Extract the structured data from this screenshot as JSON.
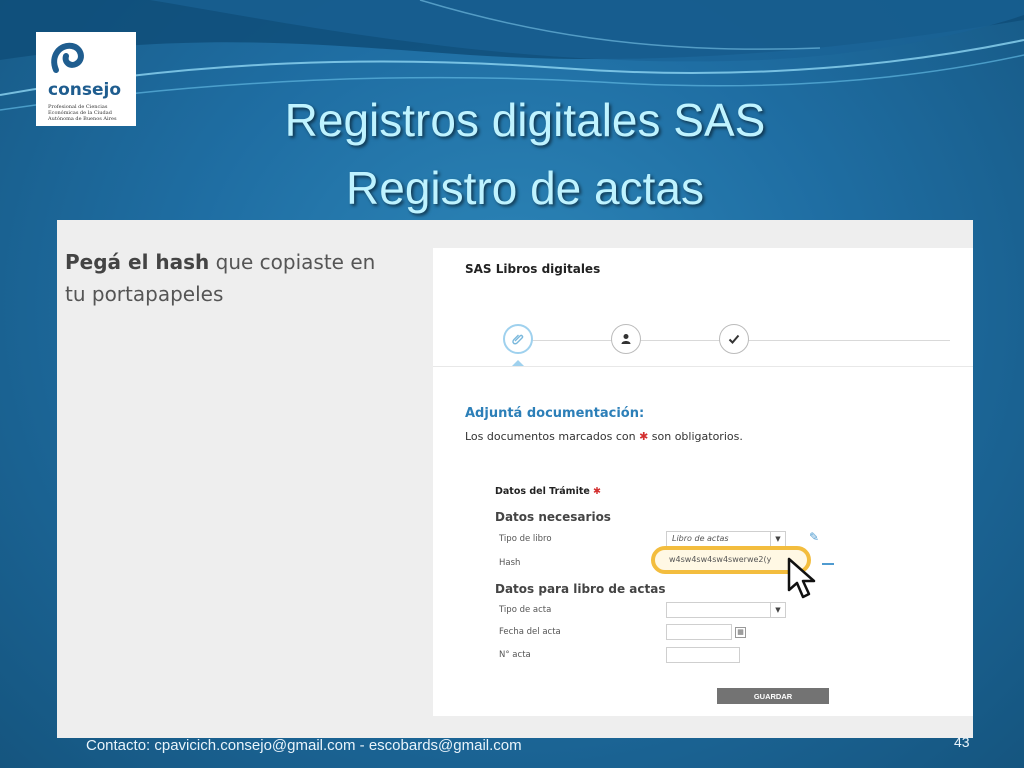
{
  "logo": {
    "name": "consejo",
    "subtitle": "Profesional de Ciencias Económicas de la Ciudad Autónoma de Buenos Aires"
  },
  "slide": {
    "title_line1": "Registros digitales SAS",
    "title_line2": "Registro de actas"
  },
  "hint": {
    "bold": "Pegá el hash",
    "rest": " que copiaste en tu portapapeles"
  },
  "form": {
    "card_title": "SAS Libros digitales",
    "steps": [
      {
        "icon": "paperclip-icon",
        "glyph": "🔗",
        "active": true
      },
      {
        "icon": "person-icon",
        "glyph": "👤",
        "active": false
      },
      {
        "icon": "check-icon",
        "glyph": "✔",
        "active": false
      }
    ],
    "section_title": "Adjuntá documentación:",
    "required_note_pre": "Los documentos marcados con ",
    "required_star": "✱",
    "required_note_post": " son obligatorios.",
    "datos_tramite": "Datos del Trámite ",
    "group1": "Datos necesarios",
    "tipo_libro_label": "Tipo de libro",
    "tipo_libro_value": "Libro de actas",
    "hash_label": "Hash",
    "hash_value": "w4sw4sw4sw4swerwe2(y",
    "group2": "Datos para libro de actas",
    "tipo_acta_label": "Tipo de acta",
    "tipo_acta_value": "",
    "fecha_acta_label": "Fecha del acta",
    "fecha_acta_value": "",
    "nro_acta_label": "N° acta",
    "nro_acta_value": "",
    "save_label": "GUARDAR"
  },
  "footer": {
    "contact": "Contacto: cpavicich.consejo@gmail.com   -   escobards@gmail.com",
    "page": "43"
  },
  "colors": {
    "title": "#bff3ff",
    "accent_blue": "#2c7fb8",
    "highlight": "#f3bd3e",
    "required": "#d32f2f"
  }
}
